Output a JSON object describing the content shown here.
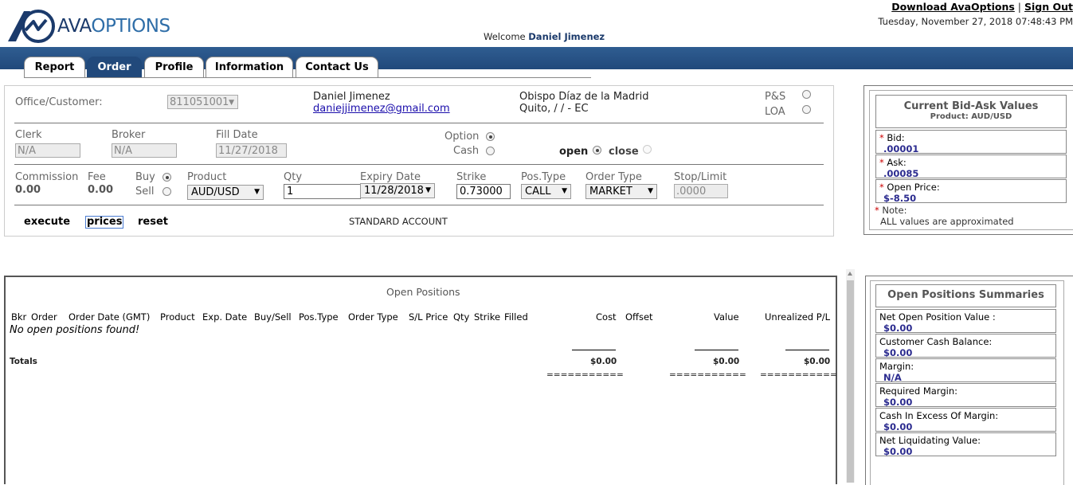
{
  "brand": {
    "ava": "AVA",
    "options": "OPTIONS",
    "colors": {
      "dark": "#1b3a6b",
      "light": "#2f6ea8"
    }
  },
  "header": {
    "download_link": "Download AvaOptions",
    "separator": "|",
    "signout_link": "Sign Out",
    "datetime": "Tuesday, November 27, 2018 07:48:43 PM",
    "welcome_prefix": "Welcome",
    "welcome_name": "Daniel Jimenez"
  },
  "tabs": [
    {
      "label": "Report",
      "active": false
    },
    {
      "label": "Order",
      "active": true
    },
    {
      "label": "Profile",
      "active": false
    },
    {
      "label": "Information",
      "active": false
    },
    {
      "label": "Contact Us",
      "active": false
    }
  ],
  "order": {
    "office_label": "Office/Customer:",
    "office_value": "811051001",
    "customer_name": "Daniel Jimenez",
    "customer_email": "daniejjimenez@gmail.com",
    "address_line1": "Obispo Díaz de la Madrid",
    "address_line2": "Quito, / / - EC",
    "ps_label": "P&S",
    "loa_label": "LOA",
    "clerk_label": "Clerk",
    "clerk_value": "N/A",
    "broker_label": "Broker",
    "broker_value": "N/A",
    "filldate_label": "Fill Date",
    "filldate_value": "11/27/2018",
    "option_label": "Option",
    "cash_label": "Cash",
    "open_label": "open",
    "close_label": "close",
    "commission_label": "Commission",
    "commission_value": "0.00",
    "fee_label": "Fee",
    "fee_value": "0.00",
    "buy_label": "Buy",
    "sell_label": "Sell",
    "product_label": "Product",
    "product_value": "AUD/USD",
    "qty_label": "Qty",
    "qty_value": "1",
    "expiry_label": "Expiry Date",
    "expiry_value": "11/28/2018",
    "strike_label": "Strike",
    "strike_value": "0.73000",
    "postype_label": "Pos.Type",
    "postype_value": "CALL",
    "ordertype_label": "Order Type",
    "ordertype_value": "MARKET",
    "stoplimit_label": "Stop/Limit",
    "stoplimit_value": ".0000",
    "execute": "execute",
    "prices": "prices",
    "reset": "reset",
    "account_type": "STANDARD ACCOUNT"
  },
  "bidask": {
    "title": "Current Bid-Ask Values",
    "product_line": "Product: AUD/USD",
    "bid_label": "Bid:",
    "bid_value": ".00001",
    "ask_label": "Ask:",
    "ask_value": ".00085",
    "openprice_label": "Open Price:",
    "openprice_value": "$-8.50",
    "note_label": "Note:",
    "note_text": "ALL values are approximated",
    "asterisk": "*"
  },
  "positions": {
    "title": "Open Positions",
    "columns": [
      "Bkr",
      "Order",
      "Order Date (GMT)",
      "Product",
      "Exp. Date",
      "Buy/Sell",
      "Pos.Type",
      "Order Type",
      "S/L Price",
      "Qty",
      "Strike",
      "Filled",
      "Cost",
      "Offset",
      "Value",
      "Unrealized P/L"
    ],
    "empty_message": "No open positions found!",
    "totals_label": "Totals",
    "cost_total": "$0.00",
    "value_total": "$0.00",
    "pl_total": "$0.00",
    "double_line": "==========="
  },
  "summaries": {
    "title": "Open Positions Summaries",
    "items": [
      {
        "label": "Net Open Position Value :",
        "value": "$0.00"
      },
      {
        "label": "Customer Cash Balance:",
        "value": "$0.00"
      },
      {
        "label": "Margin:",
        "value": "N/A"
      },
      {
        "label": "Required Margin:",
        "value": "$0.00"
      },
      {
        "label": "Cash In Excess Of Margin:",
        "value": "$0.00"
      },
      {
        "label": "Net Liquidating Value:",
        "value": "$0.00"
      }
    ]
  }
}
